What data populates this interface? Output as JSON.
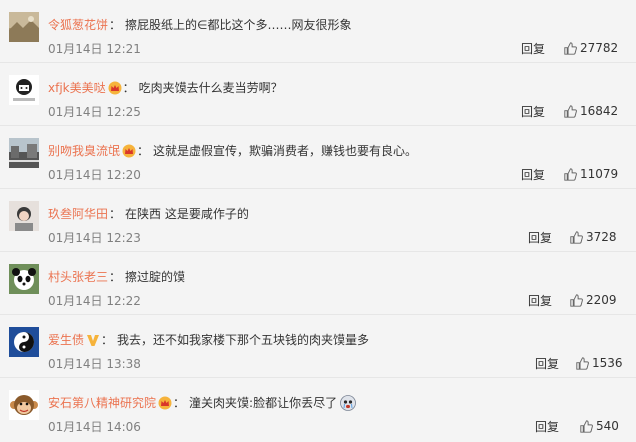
{
  "comments": [
    {
      "user": "令狐葱花饼",
      "badge": "",
      "text": "擦屁股纸上的∈都比这个多……网友很形象",
      "time": "01月14日 12:21",
      "reply_label": "回复",
      "likes": "27782",
      "avatar_icon": "landscape-avatar-icon"
    },
    {
      "user": "xfjk美美哒",
      "badge": "crown-badge",
      "text": "吃肉夹馍去什么麦当劳啊？",
      "time": "01月14日 12:25",
      "reply_label": "回复",
      "likes": "16842",
      "avatar_icon": "cartoon-avatar-icon"
    },
    {
      "user": "别吻我臭流氓",
      "badge": "crown-badge",
      "text": "这就是虚假宣传，欺骗消费者，赚钱也要有良心。",
      "time": "01月14日 12:20",
      "reply_label": "回复",
      "likes": "11079",
      "avatar_icon": "street-avatar-icon"
    },
    {
      "user": "玖叁阿华田",
      "badge": "",
      "text": "在陕西 这是要咸作子的",
      "time": "01月14日 12:23",
      "reply_label": "回复",
      "likes": "3728",
      "avatar_icon": "photo-avatar-icon"
    },
    {
      "user": "村头张老三",
      "badge": "",
      "text": "擦过腚的馍",
      "time": "01月14日 12:22",
      "reply_label": "回复",
      "likes": "2209",
      "avatar_icon": "panda-avatar-icon"
    },
    {
      "user": "爱生债",
      "badge": "verified-v-badge",
      "text": "我去，还不如我家楼下那个五块钱的肉夹馍量多",
      "time": "01月14日 13:38",
      "reply_label": "回复",
      "likes": "1536",
      "avatar_icon": "yin-yang-avatar-icon"
    },
    {
      "user": "安石第八精神研究院",
      "badge": "crown-badge",
      "text": "潼关肉夹馍:脸都让你丢尽了",
      "time": "01月14日 14:06",
      "reply_label": "回复",
      "likes": "540",
      "avatar_icon": "monkey-avatar-icon",
      "emoji": "crying-face-emoji"
    }
  ],
  "colors": {
    "username": "#eb7350",
    "text": "#333333",
    "timestamp": "#808080",
    "background": "#f4f4f4"
  }
}
